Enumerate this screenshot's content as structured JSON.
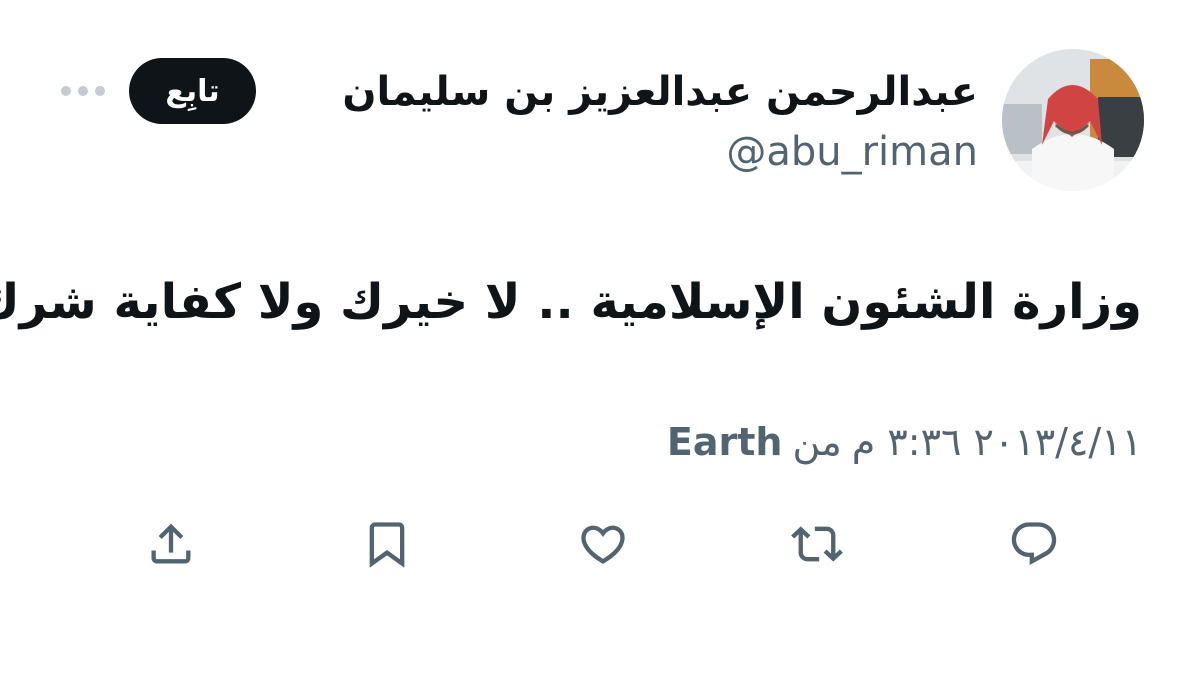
{
  "author": {
    "display_name": "عبدالرحمن عبدالعزيز بن سليمان",
    "handle": "@abu_riman"
  },
  "follow_button_label": "تابِع",
  "tweet": {
    "text": "وزارة الشئون الإسلامية .. لا خيرك ولا كفاية شرك",
    "date_time": "٢٠١٣/٤/١١ ٣:٣٦ م",
    "source_prefix": "من",
    "source": "Earth"
  },
  "icons": {
    "more": "more-horizontal-icon",
    "reply": "reply-icon",
    "retweet": "retweet-icon",
    "like": "heart-icon",
    "bookmark": "bookmark-icon",
    "share": "share-icon"
  },
  "colors": {
    "text_primary": "#0f1419",
    "text_secondary": "#536471",
    "follow_bg": "#0f1419",
    "follow_text": "#ffffff"
  }
}
